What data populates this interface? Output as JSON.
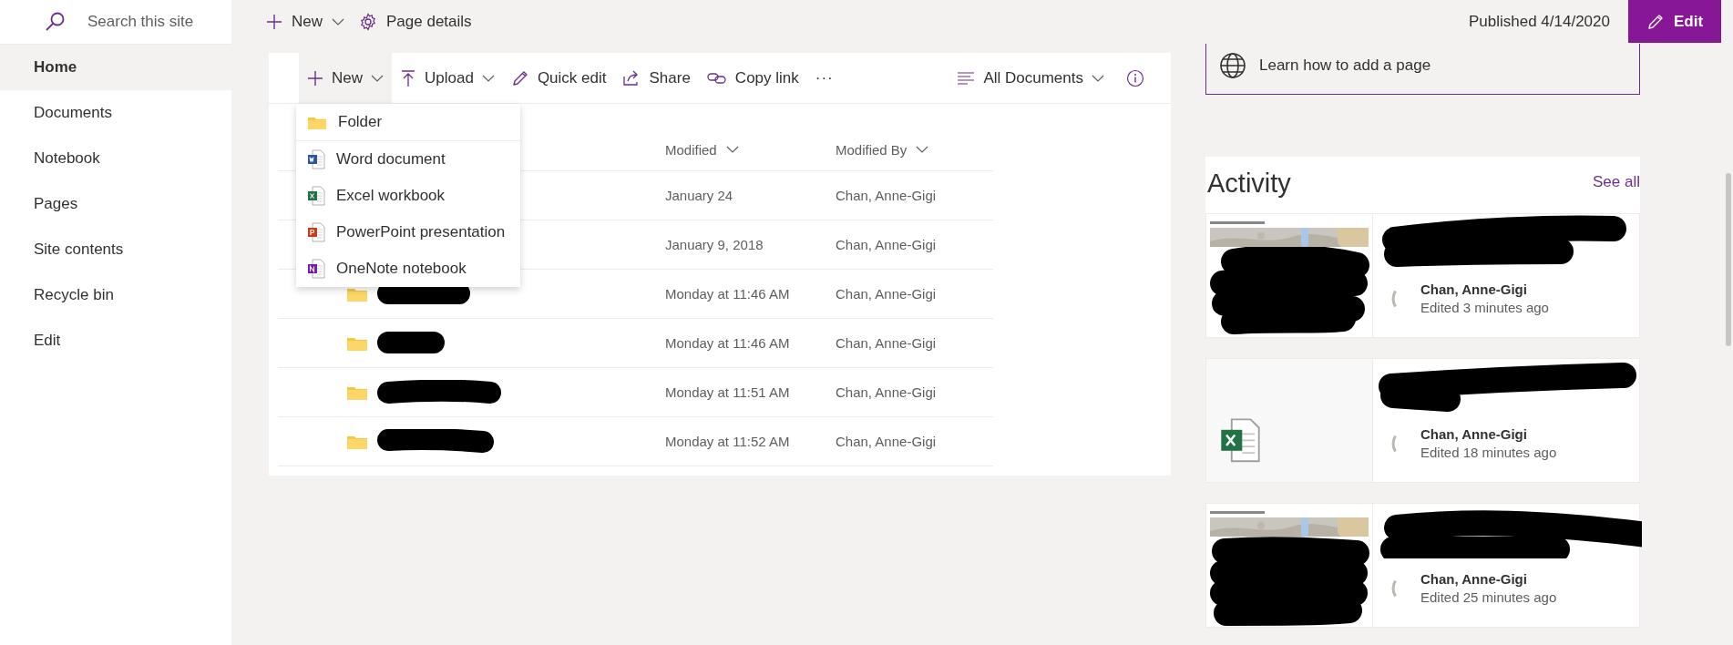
{
  "search": {
    "placeholder": "Search this site"
  },
  "sidebar": {
    "items": [
      {
        "label": "Home",
        "selected": true
      },
      {
        "label": "Documents",
        "selected": false
      },
      {
        "label": "Notebook",
        "selected": false
      },
      {
        "label": "Pages",
        "selected": false
      },
      {
        "label": "Site contents",
        "selected": false
      },
      {
        "label": "Recycle bin",
        "selected": false
      },
      {
        "label": "Edit",
        "selected": false
      }
    ]
  },
  "page_bar": {
    "new": "New",
    "page_details": "Page details",
    "published": "Published 4/14/2020",
    "edit": "Edit"
  },
  "library": {
    "toolbar": [
      {
        "kind": "new",
        "label": "New",
        "expanded": true
      },
      {
        "kind": "upload",
        "label": "Upload"
      },
      {
        "kind": "quick-edit",
        "label": "Quick edit"
      },
      {
        "kind": "share",
        "label": "Share"
      },
      {
        "kind": "copy-link",
        "label": "Copy link"
      },
      {
        "kind": "more",
        "label": "···"
      }
    ],
    "view": "All Documents",
    "columns": [
      "Modified",
      "Modified By"
    ],
    "rows": [
      {
        "modified": "January 24",
        "modified_by": "Chan, Anne-Gigi"
      },
      {
        "modified": "January 9, 2018",
        "modified_by": "Chan, Anne-Gigi"
      },
      {
        "kind": "folder",
        "modified": "Monday at 11:46 AM",
        "modified_by": "Chan, Anne-Gigi"
      },
      {
        "kind": "folder",
        "modified": "Monday at 11:46 AM",
        "modified_by": "Chan, Anne-Gigi"
      },
      {
        "kind": "folder",
        "modified": "Monday at 11:51 AM",
        "modified_by": "Chan, Anne-Gigi"
      },
      {
        "kind": "folder",
        "modified": "Monday at 11:52 AM",
        "modified_by": "Chan, Anne-Gigi"
      }
    ],
    "new_menu": [
      {
        "kind": "folder",
        "label": "Folder"
      },
      {
        "kind": "word",
        "label": "Word document"
      },
      {
        "kind": "excel",
        "label": "Excel workbook"
      },
      {
        "kind": "powerpoint",
        "label": "PowerPoint presentation"
      },
      {
        "kind": "onenote",
        "label": "OneNote notebook"
      }
    ]
  },
  "learn_link": "Learn how to add a page",
  "activity": {
    "title": "Activity",
    "see_all": "See all",
    "items": [
      {
        "kind": "picture",
        "author": "Chan, Anne-Gigi",
        "edited": "Edited 3 minutes ago"
      },
      {
        "kind": "excel",
        "author": "Chan, Anne-Gigi",
        "edited": "Edited 18 minutes ago"
      },
      {
        "kind": "picture",
        "author": "Chan, Anne-Gigi",
        "edited": "Edited 25 minutes ago"
      }
    ]
  }
}
